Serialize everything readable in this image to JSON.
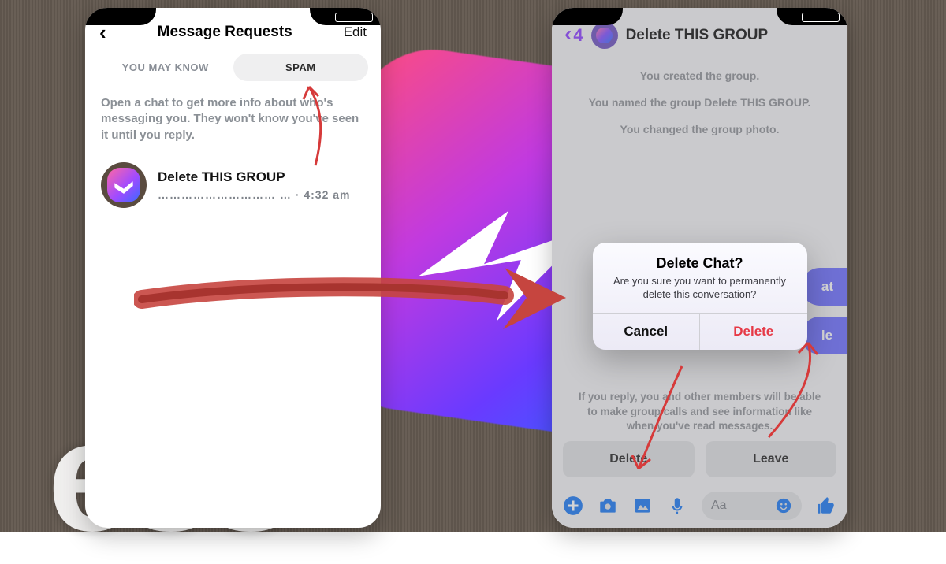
{
  "phone1": {
    "header": {
      "title": "Message Requests",
      "edit": "Edit"
    },
    "tabs": {
      "youMayKnow": "YOU MAY KNOW",
      "spam": "SPAM"
    },
    "hint": "Open a chat to get more info about who's messaging you. They won't know you've seen it until you reply.",
    "thread": {
      "name": "Delete THIS GROUP",
      "preview": "………………………… …   ·",
      "time": "4:32 am"
    }
  },
  "phone2": {
    "backBadge": "4",
    "title": "Delete THIS GROUP",
    "system": {
      "l1": "You created the group.",
      "l2": "You named the group Delete THIS GROUP.",
      "l3": "You changed the group photo."
    },
    "sidePills": {
      "a": "at",
      "b": "le"
    },
    "replyHint": "If you reply, you and other members will be able to make group calls and see information like when you've read messages.",
    "buttons": {
      "delete": "Delete",
      "leave": "Leave"
    },
    "compose": {
      "placeholder": "Aa"
    },
    "dialog": {
      "title": "Delete Chat?",
      "message": "Are you sure you want to permanently delete this conversation?",
      "cancel": "Cancel",
      "delete": "Delete"
    }
  },
  "bgWord": "ess"
}
